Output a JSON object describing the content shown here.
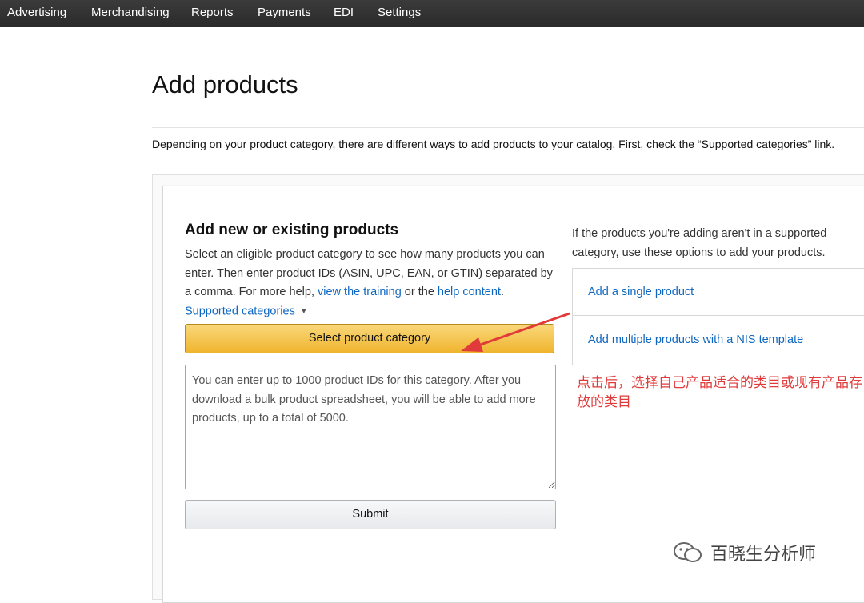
{
  "nav": {
    "items": [
      "Advertising",
      "Merchandising",
      "Reports",
      "Payments",
      "EDI",
      "Settings"
    ]
  },
  "page": {
    "title": "Add products",
    "intro": "Depending on your product category, there are different ways to add products to your catalog. First, check the “Supported categories” link."
  },
  "left": {
    "title": "Add new or existing products",
    "desc_part1": "Select an eligible product category to see how many products you can enter. Then enter product IDs (ASIN, UPC, EAN, or GTIN) separated by a comma. For more help, ",
    "link_training": "view the training",
    "desc_part2": " or the ",
    "link_help": "help content",
    "desc_part3": ". ",
    "link_supported": "Supported categories",
    "select_label": "Select product category",
    "textarea_placeholder": "You can enter up to 1000 product IDs for this category. After you download a bulk product spreadsheet, you will be able to add more products, up to a total of 5000.",
    "submit_label": "Submit"
  },
  "right": {
    "desc": "If the products you're adding aren't in a supported category, use these options to add your products.",
    "options": [
      "Add a single product",
      "Add multiple products with a NIS template"
    ]
  },
  "annotation": {
    "text": "点击后，选择自己产品适合的类目或现有产品存放的类目",
    "color": "#e03a3a"
  },
  "watermark": {
    "text": "百晓生分析师"
  },
  "icons": {
    "caret": "caret-down-icon",
    "wechat": "wechat-icon"
  }
}
